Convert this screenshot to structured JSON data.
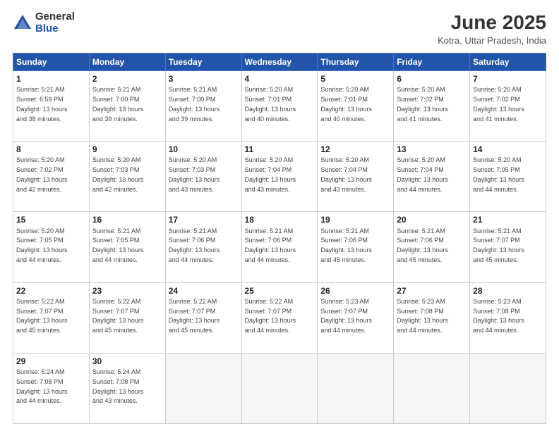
{
  "header": {
    "logo_general": "General",
    "logo_blue": "Blue",
    "month_title": "June 2025",
    "location": "Kotra, Uttar Pradesh, India"
  },
  "weekdays": [
    "Sunday",
    "Monday",
    "Tuesday",
    "Wednesday",
    "Thursday",
    "Friday",
    "Saturday"
  ],
  "weeks": [
    [
      {
        "day": "1",
        "info": "Sunrise: 5:21 AM\nSunset: 6:59 PM\nDaylight: 13 hours\nand 38 minutes."
      },
      {
        "day": "2",
        "info": "Sunrise: 5:21 AM\nSunset: 7:00 PM\nDaylight: 13 hours\nand 39 minutes."
      },
      {
        "day": "3",
        "info": "Sunrise: 5:21 AM\nSunset: 7:00 PM\nDaylight: 13 hours\nand 39 minutes."
      },
      {
        "day": "4",
        "info": "Sunrise: 5:20 AM\nSunset: 7:01 PM\nDaylight: 13 hours\nand 40 minutes."
      },
      {
        "day": "5",
        "info": "Sunrise: 5:20 AM\nSunset: 7:01 PM\nDaylight: 13 hours\nand 40 minutes."
      },
      {
        "day": "6",
        "info": "Sunrise: 5:20 AM\nSunset: 7:02 PM\nDaylight: 13 hours\nand 41 minutes."
      },
      {
        "day": "7",
        "info": "Sunrise: 5:20 AM\nSunset: 7:02 PM\nDaylight: 13 hours\nand 41 minutes."
      }
    ],
    [
      {
        "day": "8",
        "info": "Sunrise: 5:20 AM\nSunset: 7:02 PM\nDaylight: 13 hours\nand 42 minutes."
      },
      {
        "day": "9",
        "info": "Sunrise: 5:20 AM\nSunset: 7:03 PM\nDaylight: 13 hours\nand 42 minutes."
      },
      {
        "day": "10",
        "info": "Sunrise: 5:20 AM\nSunset: 7:03 PM\nDaylight: 13 hours\nand 43 minutes."
      },
      {
        "day": "11",
        "info": "Sunrise: 5:20 AM\nSunset: 7:04 PM\nDaylight: 13 hours\nand 43 minutes."
      },
      {
        "day": "12",
        "info": "Sunrise: 5:20 AM\nSunset: 7:04 PM\nDaylight: 13 hours\nand 43 minutes."
      },
      {
        "day": "13",
        "info": "Sunrise: 5:20 AM\nSunset: 7:04 PM\nDaylight: 13 hours\nand 44 minutes."
      },
      {
        "day": "14",
        "info": "Sunrise: 5:20 AM\nSunset: 7:05 PM\nDaylight: 13 hours\nand 44 minutes."
      }
    ],
    [
      {
        "day": "15",
        "info": "Sunrise: 5:20 AM\nSunset: 7:05 PM\nDaylight: 13 hours\nand 44 minutes."
      },
      {
        "day": "16",
        "info": "Sunrise: 5:21 AM\nSunset: 7:05 PM\nDaylight: 13 hours\nand 44 minutes."
      },
      {
        "day": "17",
        "info": "Sunrise: 5:21 AM\nSunset: 7:06 PM\nDaylight: 13 hours\nand 44 minutes."
      },
      {
        "day": "18",
        "info": "Sunrise: 5:21 AM\nSunset: 7:06 PM\nDaylight: 13 hours\nand 44 minutes."
      },
      {
        "day": "19",
        "info": "Sunrise: 5:21 AM\nSunset: 7:06 PM\nDaylight: 13 hours\nand 45 minutes."
      },
      {
        "day": "20",
        "info": "Sunrise: 5:21 AM\nSunset: 7:06 PM\nDaylight: 13 hours\nand 45 minutes."
      },
      {
        "day": "21",
        "info": "Sunrise: 5:21 AM\nSunset: 7:07 PM\nDaylight: 13 hours\nand 45 minutes."
      }
    ],
    [
      {
        "day": "22",
        "info": "Sunrise: 5:22 AM\nSunset: 7:07 PM\nDaylight: 13 hours\nand 45 minutes."
      },
      {
        "day": "23",
        "info": "Sunrise: 5:22 AM\nSunset: 7:07 PM\nDaylight: 13 hours\nand 45 minutes."
      },
      {
        "day": "24",
        "info": "Sunrise: 5:22 AM\nSunset: 7:07 PM\nDaylight: 13 hours\nand 45 minutes."
      },
      {
        "day": "25",
        "info": "Sunrise: 5:22 AM\nSunset: 7:07 PM\nDaylight: 13 hours\nand 44 minutes."
      },
      {
        "day": "26",
        "info": "Sunrise: 5:23 AM\nSunset: 7:07 PM\nDaylight: 13 hours\nand 44 minutes."
      },
      {
        "day": "27",
        "info": "Sunrise: 5:23 AM\nSunset: 7:08 PM\nDaylight: 13 hours\nand 44 minutes."
      },
      {
        "day": "28",
        "info": "Sunrise: 5:23 AM\nSunset: 7:08 PM\nDaylight: 13 hours\nand 44 minutes."
      }
    ],
    [
      {
        "day": "29",
        "info": "Sunrise: 5:24 AM\nSunset: 7:08 PM\nDaylight: 13 hours\nand 44 minutes."
      },
      {
        "day": "30",
        "info": "Sunrise: 5:24 AM\nSunset: 7:08 PM\nDaylight: 13 hours\nand 43 minutes."
      },
      {
        "day": "",
        "info": ""
      },
      {
        "day": "",
        "info": ""
      },
      {
        "day": "",
        "info": ""
      },
      {
        "day": "",
        "info": ""
      },
      {
        "day": "",
        "info": ""
      }
    ]
  ]
}
